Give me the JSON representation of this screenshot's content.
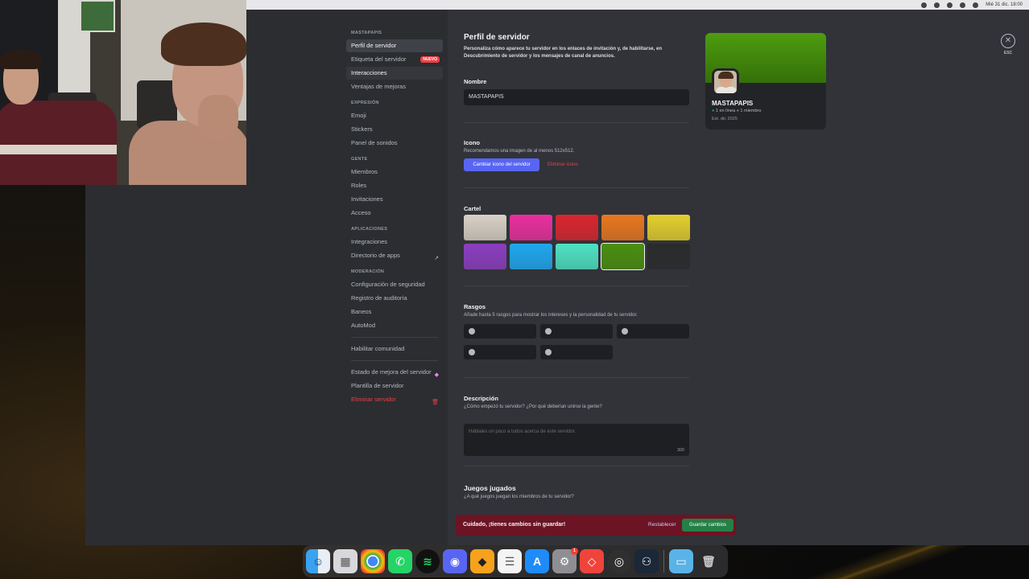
{
  "menubar": {
    "clock": "Mié 31 dic. 18:00"
  },
  "nav": {
    "categories": {
      "server": "MASTAPAPIS",
      "expression": "EXPRESIÓN",
      "people": "GENTE",
      "apps": "APLICACIONES",
      "moderation": "MODERACIÓN"
    },
    "items": {
      "server_profile": "Perfil de servidor",
      "server_tag": "Etiqueta del servidor",
      "server_tag_badge": "NUEVO",
      "interactions": "Interacciones",
      "boost_perks": "Ventajas de mejoras",
      "emoji": "Emoji",
      "stickers": "Stickers",
      "soundboard": "Panel de sonidos",
      "members": "Miembros",
      "roles": "Roles",
      "invites": "Invitaciones",
      "access": "Acceso",
      "integrations": "Integraciones",
      "app_directory": "Directorio de apps",
      "safety_setup": "Configuración de seguridad",
      "audit_log": "Registro de auditoría",
      "bans": "Baneos",
      "automod": "AutoMod",
      "enable_community": "Habilitar comunidad",
      "boost_status": "Estado de mejora del servidor",
      "server_template": "Plantilla de servidor",
      "delete_server": "Eliminar servidor"
    }
  },
  "profile": {
    "title": "Perfil de servidor",
    "description": "Personaliza cómo aparece tu servidor en los enlaces de invitación y, de habilitarse, en Descubrimiento de servidor y los mensajes de canal de anuncios.",
    "name_label": "Nombre",
    "name_value": "MASTAPAPIS",
    "icon_label": "Icono",
    "icon_hint": "Recomendamos una imagen de al menos 512x512.",
    "change_icon_button": "Cambiar icono del servidor",
    "remove_icon_button": "Eliminar icono",
    "banner_label": "Cartel",
    "banner_colors": [
      "#d9d1c6",
      "#ea2f9e",
      "#d9262e",
      "#e8771f",
      "#e3cf2c",
      "#8b3ec0",
      "#1fa8ee",
      "#4ee2c3",
      "#4a8f0f",
      "#2a2b2d"
    ],
    "banner_selected_index": 8,
    "traits_label": "Rasgos",
    "traits_hint": "Añade hasta 5 rasgos para mostrar los intereses y la personalidad de tu servidor.",
    "description_label": "Descripción",
    "description_hint": "¿Cómo empezó tu servidor? ¿Por qué deberían unirse la gente?",
    "description_placeholder": "Háblales un poco a todos acerca de este servidor.",
    "description_count": "300",
    "games_title": "Juegos jugados",
    "games_hint": "¿A qué juegos juegan los miembros de tu servidor?"
  },
  "preview": {
    "name": "MASTAPAPIS",
    "online": "1 en línea",
    "members": "1 miembro",
    "established": "Est. dic 2025"
  },
  "close": {
    "label": "ESC"
  },
  "savebar": {
    "message": "Cuidado, ¡tienes cambios sin guardar!",
    "reset": "Restablecer",
    "save": "Guardar cambios"
  },
  "dock": {
    "apps": [
      "finder-icon",
      "launchpad-icon",
      "chrome-icon",
      "whatsapp-icon",
      "spotify-icon",
      "discord-icon",
      "maps-icon",
      "reminders-icon",
      "app-store-icon",
      "system-settings-icon",
      "anydesk-icon",
      "obs-icon",
      "steam-icon",
      "downloads-folder-icon",
      "trash-icon"
    ],
    "settings_badge": "1"
  }
}
